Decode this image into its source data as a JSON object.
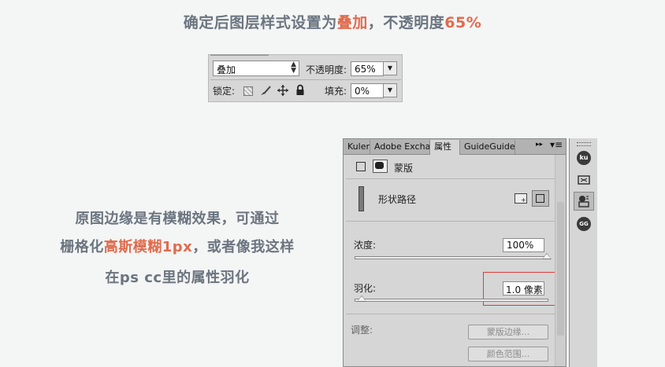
{
  "heading": {
    "prefix": "确定后图层样式设置为",
    "blend_word": "叠加",
    "middle": "，不透明度",
    "opacity_word": "65%"
  },
  "description": {
    "line1": "原图边缘是有模糊效果，可通过",
    "line2_prefix": "栅格化",
    "line2_highlight": "高斯模糊1px",
    "line2_suffix": "，或者像我这样",
    "line3": "在ps cc里的属性羽化"
  },
  "layer_bar": {
    "blend_mode": "叠加",
    "opacity_label": "不透明度:",
    "opacity_value": "65%",
    "lock_label": "锁定:",
    "fill_label": "填充:",
    "fill_value": "0%",
    "lock_icons": [
      "lock-transparent-pixels-icon",
      "lock-image-pixels-brush-icon",
      "lock-position-move-icon",
      "lock-all-padlock-icon"
    ]
  },
  "properties_panel": {
    "tabs": [
      "Kuler",
      "Adobe Exchar",
      "属性",
      "GuideGuide"
    ],
    "active_tab": "属性",
    "menu_glyph": "▸▸",
    "mask_type_label": "蒙版",
    "shape_path_label": "形状路径",
    "density_label": "浓度:",
    "density_value": "100%",
    "density_fraction": 1.0,
    "feather_label": "羽化:",
    "feather_value": "1.0 像素",
    "feather_fraction": 0.02,
    "refine_label": "调整:",
    "mask_edge_button": "蒙版边缘...",
    "color_range_button": "颜色范围...",
    "highlight_color": "#e03a3a"
  },
  "dock": {
    "icons": [
      "kuler-icon",
      "adobe-exchange-icon",
      "properties-icon",
      "guideguide-icon"
    ],
    "kuler_text": "ku",
    "guide_text": "GG"
  },
  "colors": {
    "accent": "#e06b4d",
    "heading_text": "#6b7580",
    "panel_bg": "#d6d6d6"
  }
}
